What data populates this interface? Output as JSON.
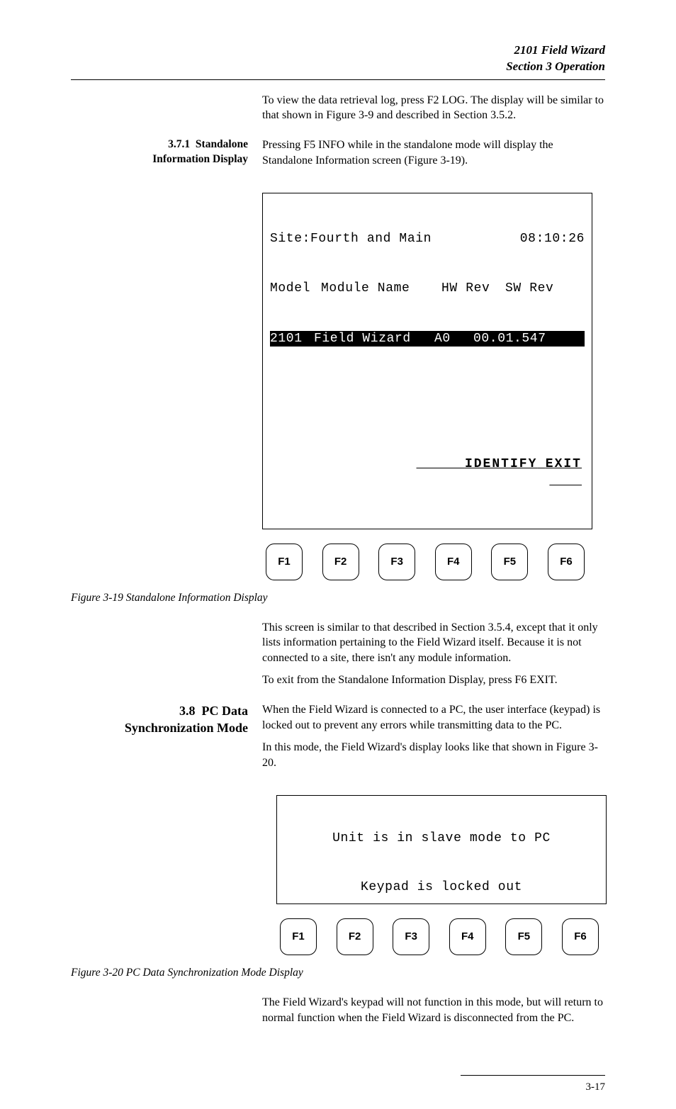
{
  "header": {
    "title": "2101 Field Wizard",
    "section": "Section 3   Operation"
  },
  "intro": {
    "p1": "To view the data retrieval log, press F2 LOG. The display will be similar to that shown in Figure 3-9 and described in Section 3.5.2."
  },
  "sec371": {
    "num": "3.7.1",
    "title1": "Standalone",
    "title2": "Information Display",
    "p1": "Pressing F5 INFO while in the standalone mode will display the Standalone Information screen (Figure 3-19)."
  },
  "lcd1": {
    "site": "Site:Fourth and Main",
    "clock": "08:10:26",
    "h_model": "Model",
    "h_module": "Module Name",
    "h_hw": "HW Rev",
    "h_sw": "SW Rev",
    "r_model": "2101",
    "r_name": "Field Wizard",
    "r_hw": "A0",
    "r_sw": "00.01.547",
    "identify": "IDENTIFY",
    "exit": "EXIT"
  },
  "fkeys": [
    "F1",
    "F2",
    "F3",
    "F4",
    "F5",
    "F6"
  ],
  "fig319": "Figure 3-19 Standalone Information Display",
  "after319": {
    "p1": "This screen is similar to that described in Section 3.5.4, except that it only lists information pertaining to the Field Wizard itself. Because it is not connected to a site, there isn't any module information.",
    "p2": "To exit from the Standalone Information Display, press F6 EXIT."
  },
  "sec38": {
    "num": "3.8",
    "title1": "PC Data",
    "title2": "Synchronization Mode",
    "p1": "When the Field Wizard is connected to a PC, the user interface (keypad) is locked out to prevent any errors while transmitting data to the PC.",
    "p2": "In this mode, the Field Wizard's display looks like that shown in Figure 3-20."
  },
  "lcd2": {
    "line1": "Unit is in slave mode to PC",
    "line2": "Keypad is locked out"
  },
  "fig320": "Figure 3-20 PC Data Synchronization Mode Display",
  "after320": {
    "p1": "The Field Wizard's keypad will not function in this mode, but will return to normal function when the Field Wizard is disconnected from the PC."
  },
  "page": "3-17"
}
